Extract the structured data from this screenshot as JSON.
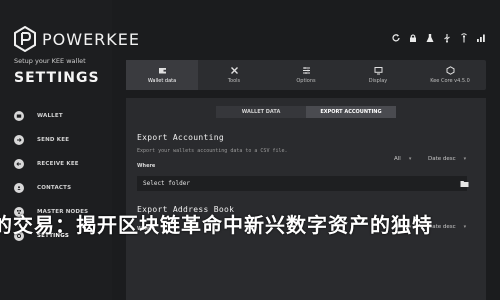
{
  "brand": {
    "name": "POWERKEE"
  },
  "sidebar": {
    "subtitle": "Setup your KEE wallet",
    "title": "SETTINGS",
    "items": [
      {
        "label": "WALLET",
        "icon": "wallet-icon"
      },
      {
        "label": "SEND KEE",
        "icon": "send-icon"
      },
      {
        "label": "RECEIVE KEE",
        "icon": "receive-icon"
      },
      {
        "label": "CONTACTS",
        "icon": "contacts-icon"
      },
      {
        "label": "MASTER NODES",
        "icon": "masternodes-icon"
      },
      {
        "label": "SETTINGS",
        "icon": "settings-icon",
        "active": true
      }
    ]
  },
  "top_icons": [
    "refresh-icon",
    "lock-icon",
    "flask-icon",
    "usb-icon",
    "antenna-icon",
    "network-icon"
  ],
  "toolbar": {
    "items": [
      {
        "label": "Wallet data",
        "icon": "wallet-data-icon",
        "active": true
      },
      {
        "label": "Tools",
        "icon": "tools-icon"
      },
      {
        "label": "Options",
        "icon": "options-icon"
      },
      {
        "label": "Display",
        "icon": "display-icon"
      },
      {
        "label": "Kee Core v4.5.0",
        "icon": "core-icon"
      }
    ]
  },
  "tabs": [
    {
      "label": "WALLET DATA"
    },
    {
      "label": "EXPORT ACCOUNTING",
      "active": true
    }
  ],
  "export_accounting": {
    "title": "Export Accounting",
    "description": "Export your wallets accounting data to a CSV file.",
    "where_label": "Where",
    "filter_value": "All",
    "sort_value": "Date desc",
    "folder_placeholder": "Select folder"
  },
  "export_address_book": {
    "title": "Export Address Book",
    "where_label": "Where",
    "filter_value": "All",
    "sort_value": "Date desc"
  },
  "overlay_banner": "的交易：揭开区块链革命中新兴数字资产的独特"
}
